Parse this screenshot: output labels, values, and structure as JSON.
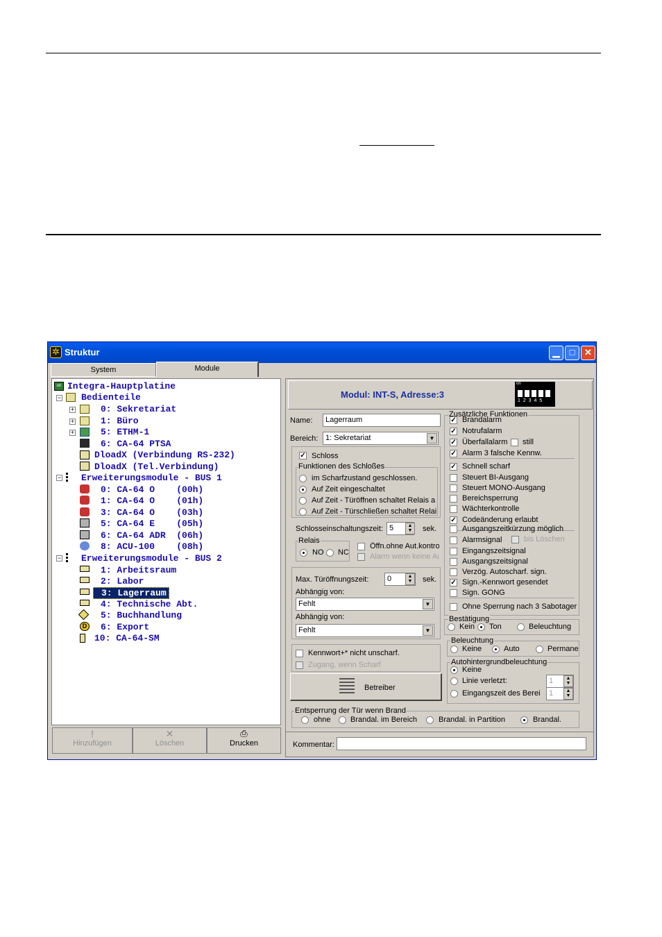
{
  "window": {
    "title": "Struktur"
  },
  "tabs": [
    {
      "label": "System"
    },
    {
      "label": "Module"
    }
  ],
  "tree": [
    {
      "label": "Integra-Hauptplatine"
    },
    {
      "label": "Bedienteile"
    },
    {
      "label": "0: Sekretariat"
    },
    {
      "label": "1: Büro"
    },
    {
      "label": "5: ETHM-1"
    },
    {
      "label": "6: CA-64 PTSA"
    },
    {
      "label": "DloadX (Verbindung RS-232)"
    },
    {
      "label": "DloadX (Tel.Verbindung)"
    },
    {
      "label": "Erweiterungsmodule - BUS 1"
    },
    {
      "label": "0: CA-64 O    (00h)"
    },
    {
      "label": "1: CA-64 O    (01h)"
    },
    {
      "label": "3: CA-64 O    (03h)"
    },
    {
      "label": "5: CA-64 E    (05h)"
    },
    {
      "label": "6: CA-64 ADR  (06h)"
    },
    {
      "label": "8: ACU-100    (08h)"
    },
    {
      "label": "Erweiterungsmodule - BUS 2"
    },
    {
      "label": "1: Arbeitsraum"
    },
    {
      "label": "2: Labor"
    },
    {
      "label": "3: Lagerraum"
    },
    {
      "label": "4: Technische Abt."
    },
    {
      "label": "5: Buchhandlung"
    },
    {
      "label": "6: Export"
    },
    {
      "label": "10: CA-64-SM"
    }
  ],
  "bottom_buttons": {
    "add": "Hinzufügen",
    "delete": "Löschen",
    "print": "Drucken"
  },
  "module_header": "Modul: INT-S, Adresse:3",
  "dip": {
    "on": "on",
    "nums": "1 2 3 4 5"
  },
  "form": {
    "name_label": "Name:",
    "name_value": "Lagerraum",
    "area_label": "Bereich:",
    "area_value": "1: Sekretariat",
    "lock": "Schloss",
    "lock_functions": "Funktionen des Schloßes",
    "lock_opts": [
      "im Scharfzustand geschlossen.",
      "Auf Zeit eingeschaltet",
      "Auf Zeit - Türöffnen schaltet Relais a",
      "Auf Zeit - Türschließen schaltet Relai"
    ],
    "lock_time_label": "Schlosseinschaltungszeit:",
    "lock_time_value": "5",
    "sec": "sek.",
    "relay": "Relais",
    "no": "NO",
    "nc": "NC",
    "open_no_auth": "Öffn.ohne Aut.kontro",
    "alarm_no_auth": "Alarm wenn keine Au",
    "max_open_label": "Max. Türöffnungszeit:",
    "max_open_value": "0",
    "depends1": "Abhängig von:",
    "depends1_value": "Fehlt",
    "depends2": "Abhängig von:",
    "depends2_value": "Fehlt",
    "pw_not_disarm": "Kennwort+* nicht unscharf.",
    "access_armed": "Zugang, wenn Scharf",
    "operators": "Betreiber"
  },
  "extra": {
    "title": "Zusätzliche Funktionen",
    "items": [
      "Brandalarm",
      "Notrufalarm",
      "Überfallalarm",
      "Alarm 3 falsche Kennw.",
      "Schnell scharf",
      "Steuert BI-Ausgang",
      "Steuert MONO-Ausgang",
      "Bereichsperrung",
      "Wächterkontrolle",
      "Codeänderung erlaubt",
      "Ausgangszeitkürzung möglich",
      "Alarmsignal",
      "Eingangszeitsignal",
      "Ausgangszeitsignal",
      "Verzög. Autoscharf. sign.",
      "Sign.-Kennwort gesendet",
      "Sign. GONG",
      "Ohne Sperrung nach 3 Sabotager"
    ],
    "still": "still",
    "bis_loeschen": "bis Löschen"
  },
  "confirm": {
    "title": "Bestätigung",
    "opts": [
      "Kein",
      "Ton",
      "Beleuchtung"
    ]
  },
  "backlight": {
    "title": "Beleuchtung",
    "opts": [
      "Keine",
      "Auto",
      "Permane"
    ]
  },
  "autobl": {
    "title": "Autohintergrundbeleuchtung",
    "opts": [
      "Keine",
      "Linie verletzt:",
      "Eingangszeit des Berei"
    ],
    "v1": "1",
    "v2": "1"
  },
  "fire": {
    "title": "Entsperrung der Tür wenn Brand",
    "opts": [
      "ohne",
      "Brandal. im Bereich",
      "Brandal. in Partition",
      "Brandal."
    ]
  },
  "comment_label": "Kommentar:"
}
